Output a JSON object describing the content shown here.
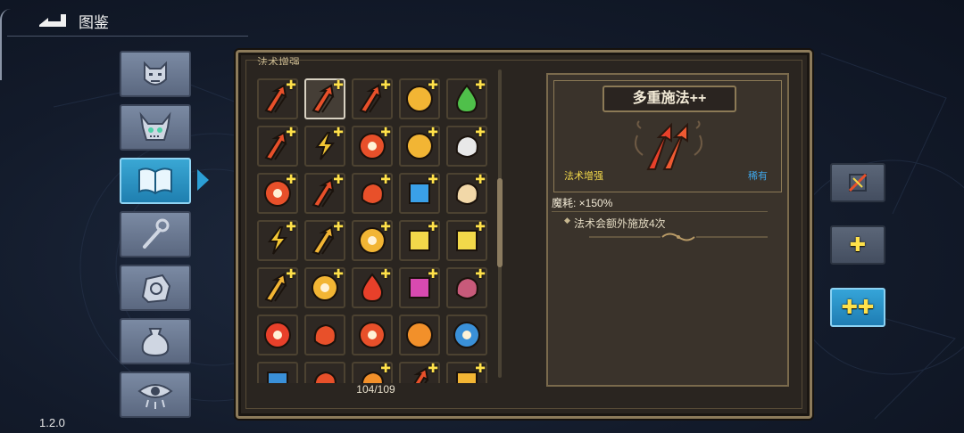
{
  "header": {
    "title": "图鉴"
  },
  "version": "1.2.0",
  "category_tabs": [
    {
      "icon": "demon-face-icon",
      "active": false
    },
    {
      "icon": "horned-skull-icon",
      "active": false
    },
    {
      "icon": "book-icon",
      "active": true
    },
    {
      "icon": "staff-icon",
      "active": false
    },
    {
      "icon": "hand-icon",
      "active": false
    },
    {
      "icon": "potion-bag-icon",
      "active": false
    },
    {
      "icon": "eye-icon",
      "active": false
    }
  ],
  "grid": {
    "section_title": "法术增强",
    "count_label": "104/109",
    "cells": [
      {
        "icon": "triple-arrow-icon",
        "plus": true,
        "color": "#e8502a"
      },
      {
        "icon": "double-arrow-icon",
        "plus": true,
        "color": "#e8502a",
        "selected": true
      },
      {
        "icon": "spread-arrow-icon",
        "plus": true,
        "color": "#e8502a"
      },
      {
        "icon": "gold-burst-icon",
        "plus": true,
        "color": "#f2b534"
      },
      {
        "icon": "green-drop-icon",
        "plus": true,
        "color": "#4fc04a"
      },
      {
        "icon": "crossed-arrow-icon",
        "plus": true,
        "color": "#e8502a"
      },
      {
        "icon": "lightning-icon",
        "plus": true,
        "color": "#f2c634"
      },
      {
        "icon": "pause-icon",
        "plus": true,
        "color": "#e8502a"
      },
      {
        "icon": "crescent-icon",
        "plus": true,
        "color": "#f2b534"
      },
      {
        "icon": "mouse-icon",
        "plus": true,
        "color": "#e8e8e8"
      },
      {
        "icon": "target-icon",
        "plus": true,
        "color": "#e8502a"
      },
      {
        "icon": "zigzag-arrow-icon",
        "plus": true,
        "color": "#e8502a"
      },
      {
        "icon": "tri-split-icon",
        "plus": true,
        "color": "#e8502a"
      },
      {
        "icon": "blue-crystal-icon",
        "plus": true,
        "color": "#3aa0e8"
      },
      {
        "icon": "larva-icon",
        "plus": true,
        "color": "#f2d8a8"
      },
      {
        "icon": "bolt-split-icon",
        "plus": true,
        "color": "#f2c634"
      },
      {
        "icon": "up-arrows-icon",
        "plus": true,
        "color": "#f2b534"
      },
      {
        "icon": "cross-orb-icon",
        "plus": true,
        "color": "#f2b534"
      },
      {
        "icon": "battery-icon",
        "plus": true,
        "color": "#f2d84a"
      },
      {
        "icon": "grid-rune-icon",
        "plus": true,
        "color": "#f2d84a"
      },
      {
        "icon": "chevrons-icon",
        "plus": true,
        "color": "#f2b534"
      },
      {
        "icon": "sun-icon",
        "plus": true,
        "color": "#f2b534"
      },
      {
        "icon": "red-flask-icon",
        "plus": true,
        "color": "#e8402a"
      },
      {
        "icon": "prism-cube-icon",
        "plus": true,
        "color": "#d84ab0"
      },
      {
        "icon": "worm-icon",
        "plus": true,
        "color": "#c85a7a"
      },
      {
        "icon": "red-flower-icon",
        "plus": false,
        "color": "#e8402a"
      },
      {
        "icon": "splash-icon",
        "plus": false,
        "color": "#e8502a"
      },
      {
        "icon": "pinwheel-icon",
        "plus": false,
        "color": "#e8502a"
      },
      {
        "icon": "hook-icon",
        "plus": false,
        "color": "#f2902a"
      },
      {
        "icon": "vortex-icon",
        "plus": false,
        "color": "#3a90d8"
      },
      {
        "icon": "blue-pillars-icon",
        "plus": false,
        "color": "#3a90d8"
      },
      {
        "icon": "red-beast-icon",
        "plus": false,
        "color": "#e8502a"
      },
      {
        "icon": "fire-spark-icon",
        "plus": true,
        "color": "#f2902a"
      },
      {
        "icon": "red-spikes-icon",
        "plus": true,
        "color": "#e8502a"
      },
      {
        "icon": "gold-rune-icon",
        "plus": true,
        "color": "#f2b534"
      }
    ]
  },
  "detail": {
    "title": "多重施法++",
    "category": "法术增强",
    "rarity": "稀有",
    "cost": "魔耗: ×150%",
    "effect": "法术会额外施放4次",
    "icon": "double-arrow-icon"
  },
  "side_buttons": [
    {
      "icon": "slash-icon",
      "active": false
    },
    {
      "icon": "plus-icon",
      "label": "✚",
      "active": false
    },
    {
      "icon": "double-plus-icon",
      "label": "✚✚",
      "active": true
    }
  ],
  "colors": {
    "accent_blue": "#2b9fd6",
    "gold_plus": "#ffe14a",
    "panel_border": "#8c7b5b",
    "rarity_blue": "#3fa5e8",
    "category_yellow": "#f2d84a"
  }
}
